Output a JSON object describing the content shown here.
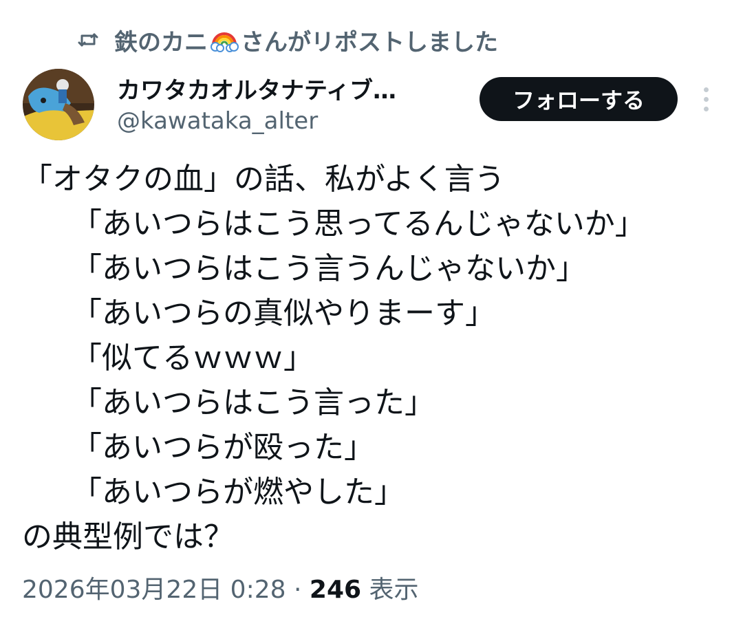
{
  "repost": {
    "reposter_name": "鉄のカニ",
    "reposter_emoji": "rainbow-cloud-icon",
    "label": "さんがリポストしました"
  },
  "author": {
    "display_name": "カワタカオルタナティブ…",
    "handle": "@kawataka_alter"
  },
  "actions": {
    "follow_label": "フォローする"
  },
  "tweet": {
    "lines": [
      "「オタクの血」の話、私がよく言う",
      "「あいつらはこう思ってるんじゃないか」",
      "「あいつらはこう言うんじゃないか」",
      "「あいつらの真似やりまーす」",
      "「似てるｗｗｗ」",
      "「あいつらはこう言った」",
      "「あいつらが殴った」",
      "「あいつらが燃やした」",
      "の典型例では？"
    ]
  },
  "meta": {
    "timestamp": "2026年03月22日 0:28",
    "separator": "·",
    "views_count": "246",
    "views_label": "表示"
  },
  "colors": {
    "text_primary": "#0f1419",
    "text_secondary": "#536471",
    "follow_bg": "#0f1419",
    "follow_text": "#ffffff",
    "more_dots": "#c5ccd2"
  }
}
